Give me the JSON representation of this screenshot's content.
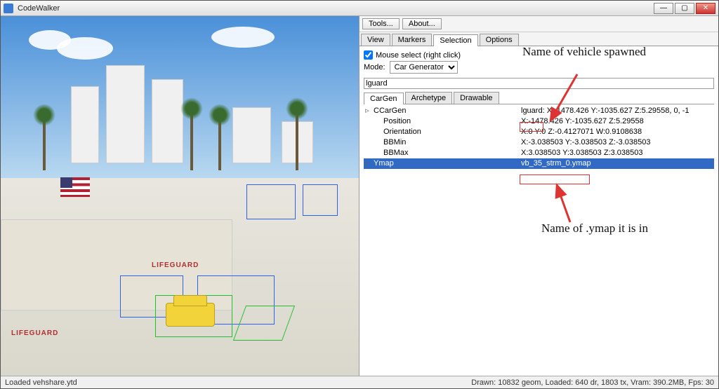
{
  "window": {
    "title": "CodeWalker",
    "min": "—",
    "max": "▢",
    "close": "✕"
  },
  "toolbar": {
    "tools": "Tools...",
    "about": "About..."
  },
  "tabs": {
    "view": "View",
    "markers": "Markers",
    "selection": "Selection",
    "options": "Options"
  },
  "selection": {
    "mouse_label": "Mouse select (right click)",
    "mode_label": "Mode:",
    "mode_value": "Car Generator",
    "name_value": "lguard",
    "subtabs": {
      "cargen": "CarGen",
      "arch": "Archetype",
      "drawable": "Drawable"
    },
    "props": {
      "ccargen_k": "CCarGen",
      "ccargen_v": "lguard: X:-1478.426 Y:-1035.627 Z:5.29558, 0, -1",
      "position_k": "Position",
      "position_v": "X:-1478.426 Y:-1035.627 Z:5.29558",
      "orient_k": "Orientation",
      "orient_v": "X:0 Y:0 Z:-0.4127071 W:0.9108638",
      "bbmin_k": "BBMin",
      "bbmin_v": "X:-3.038503 Y:-3.038503 Z:-3.038503",
      "bbmax_k": "BBMax",
      "bbmax_v": "X:3.038503 Y:3.038503 Z:3.038503",
      "ymap_k": "Ymap",
      "ymap_v": "vb_35_strm_0.ymap"
    }
  },
  "annotations": {
    "top": "Name of vehicle spawned",
    "bottom": "Name of .ymap it is in"
  },
  "building_signs": {
    "lg1": "LIFEGUARD",
    "lg2": "LIFEGUARD"
  },
  "status": {
    "left": "Loaded vehshare.ytd",
    "right": "Drawn: 10832 geom, Loaded: 640 dr, 1803 tx, Vram: 390.2MB, Fps: 30"
  }
}
